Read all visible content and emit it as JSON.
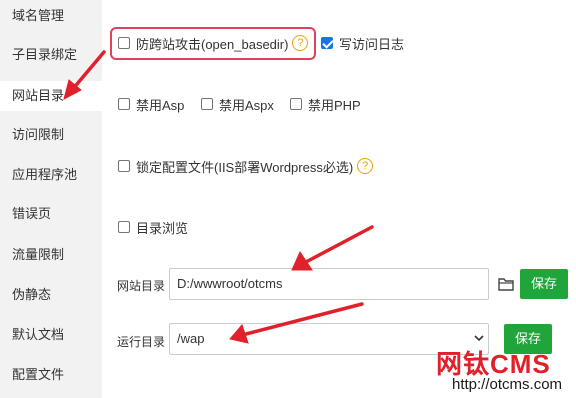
{
  "sidebar": {
    "items": [
      {
        "label": "域名管理"
      },
      {
        "label": "子目录绑定"
      },
      {
        "label": "网站目录"
      },
      {
        "label": "访问限制"
      },
      {
        "label": "应用程序池"
      },
      {
        "label": "错误页"
      },
      {
        "label": "流量限制"
      },
      {
        "label": "伪静态"
      },
      {
        "label": "默认文档"
      },
      {
        "label": "配置文件"
      }
    ],
    "active_index": 2
  },
  "options": {
    "anti_cross_site": {
      "label": "防跨站攻击(open_basedir)",
      "checked": false,
      "help": "?"
    },
    "access_log": {
      "label": "写访问日志",
      "checked": true
    },
    "disable_asp": {
      "label": "禁用Asp",
      "checked": false
    },
    "disable_aspx": {
      "label": "禁用Aspx",
      "checked": false
    },
    "disable_php": {
      "label": "禁用PHP",
      "checked": false
    },
    "lock_config": {
      "label": "锁定配置文件(IIS部署Wordpress必选)",
      "checked": false,
      "help": "?"
    },
    "dir_browse": {
      "label": "目录浏览",
      "checked": false
    }
  },
  "site_dir": {
    "label": "网站目录",
    "value": "D:/wwwroot/otcms",
    "save_label": "保存"
  },
  "run_dir": {
    "label": "运行目录",
    "value": "/wap",
    "save_label": "保存"
  },
  "watermark": {
    "logo": "网钛CMS",
    "url": "http://otcms.com"
  },
  "colors": {
    "accent_green": "#20a53a",
    "highlight_red": "#e0415b",
    "checkbox_blue": "#1a73e8",
    "help_orange": "#e8a100"
  }
}
